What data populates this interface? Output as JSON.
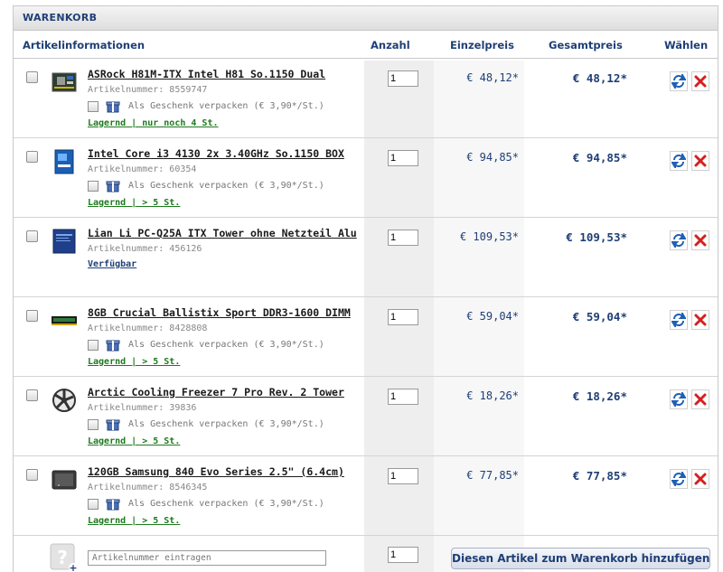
{
  "cart": {
    "title": "WARENKORB"
  },
  "columns": {
    "info": "Artikelinformationen",
    "qty": "Anzahl",
    "unit": "Einzelpreis",
    "total": "Gesamtpreis",
    "select": "Wählen"
  },
  "items": [
    {
      "name": "ASRock H81M-ITX Intel H81 So.1150 Dual",
      "artnr_label": "Artikelnummer:",
      "artnr": "8559747",
      "gift": "Als Geschenk verpacken (€ 3,90*/St.)",
      "stock": "Lagernd | nur noch 4 St.",
      "qty": "1",
      "unit_price": "€ 48,12*",
      "total_price": "€ 48,12*",
      "icon": "motherboard-icon"
    },
    {
      "name": "Intel Core i3 4130 2x 3.40GHz So.1150 BOX",
      "artnr_label": "Artikelnummer:",
      "artnr": "60354",
      "gift": "Als Geschenk verpacken (€ 3,90*/St.)",
      "stock": "Lagernd | > 5 St.",
      "qty": "1",
      "unit_price": "€ 94,85*",
      "total_price": "€ 94,85*",
      "icon": "cpu-box-icon"
    },
    {
      "name": "Lian Li PC-Q25A ITX Tower ohne Netzteil Alu",
      "artnr_label": "Artikelnummer:",
      "artnr": "456126",
      "gift": "",
      "stock": "Verfügbar",
      "qty": "1",
      "unit_price": "€ 109,53*",
      "total_price": "€ 109,53*",
      "icon": "case-icon"
    },
    {
      "name": "8GB Crucial Ballistix Sport DDR3-1600 DIMM",
      "artnr_label": "Artikelnummer:",
      "artnr": "8428808",
      "gift": "Als Geschenk verpacken (€ 3,90*/St.)",
      "stock": "Lagernd | > 5 St.",
      "qty": "1",
      "unit_price": "€ 59,04*",
      "total_price": "€ 59,04*",
      "icon": "ram-icon"
    },
    {
      "name": "Arctic Cooling Freezer 7 Pro Rev. 2 Tower",
      "artnr_label": "Artikelnummer:",
      "artnr": "39836",
      "gift": "Als Geschenk verpacken (€ 3,90*/St.)",
      "stock": "Lagernd | > 5 St.",
      "qty": "1",
      "unit_price": "€ 18,26*",
      "total_price": "€ 18,26*",
      "icon": "cooler-icon"
    },
    {
      "name": "120GB Samsung 840 Evo Series 2.5\" (6.4cm)",
      "artnr_label": "Artikelnummer:",
      "artnr": "8546345",
      "gift": "Als Geschenk verpacken (€ 3,90*/St.)",
      "stock": "Lagernd | > 5 St.",
      "qty": "1",
      "unit_price": "€ 77,85*",
      "total_price": "€ 77,85*",
      "icon": "ssd-icon"
    }
  ],
  "add": {
    "placeholder": "Artikelnummer eintragen",
    "qty": "1",
    "button": "Diesen Artikel zum Warenkorb hinzufügen"
  },
  "colors": {
    "accent": "#1f3f76",
    "stock_green": "#1d7a1d",
    "remove_red": "#d42020"
  }
}
